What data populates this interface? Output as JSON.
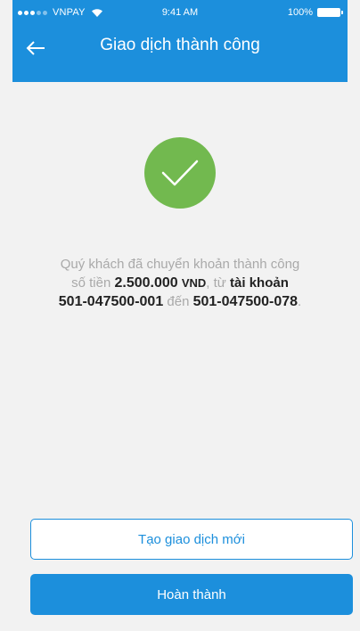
{
  "status_bar": {
    "carrier": "VNPAY",
    "time": "9:41 AM",
    "battery": "100%"
  },
  "nav": {
    "title": "Giao dịch thành công",
    "back_icon": "arrow-left-icon"
  },
  "success": {
    "icon": "checkmark-icon",
    "color": "#72b94f"
  },
  "message": {
    "line1": "Quý khách đã chuyển khoản thành công",
    "so_tien_label": "số tiền",
    "amount": "2.500.000",
    "currency": "VND",
    "tu_label": "từ",
    "account_label": "tài khoản",
    "from_account": "501-047500-001",
    "den_label": "đến",
    "to_account": "501-047500-078",
    "end_punct": "."
  },
  "buttons": {
    "new_transaction": "Tạo giao dịch mới",
    "done": "Hoàn thành"
  },
  "colors": {
    "primary": "#1c8fdc",
    "success": "#72b94f",
    "background": "#f2f2f2"
  }
}
